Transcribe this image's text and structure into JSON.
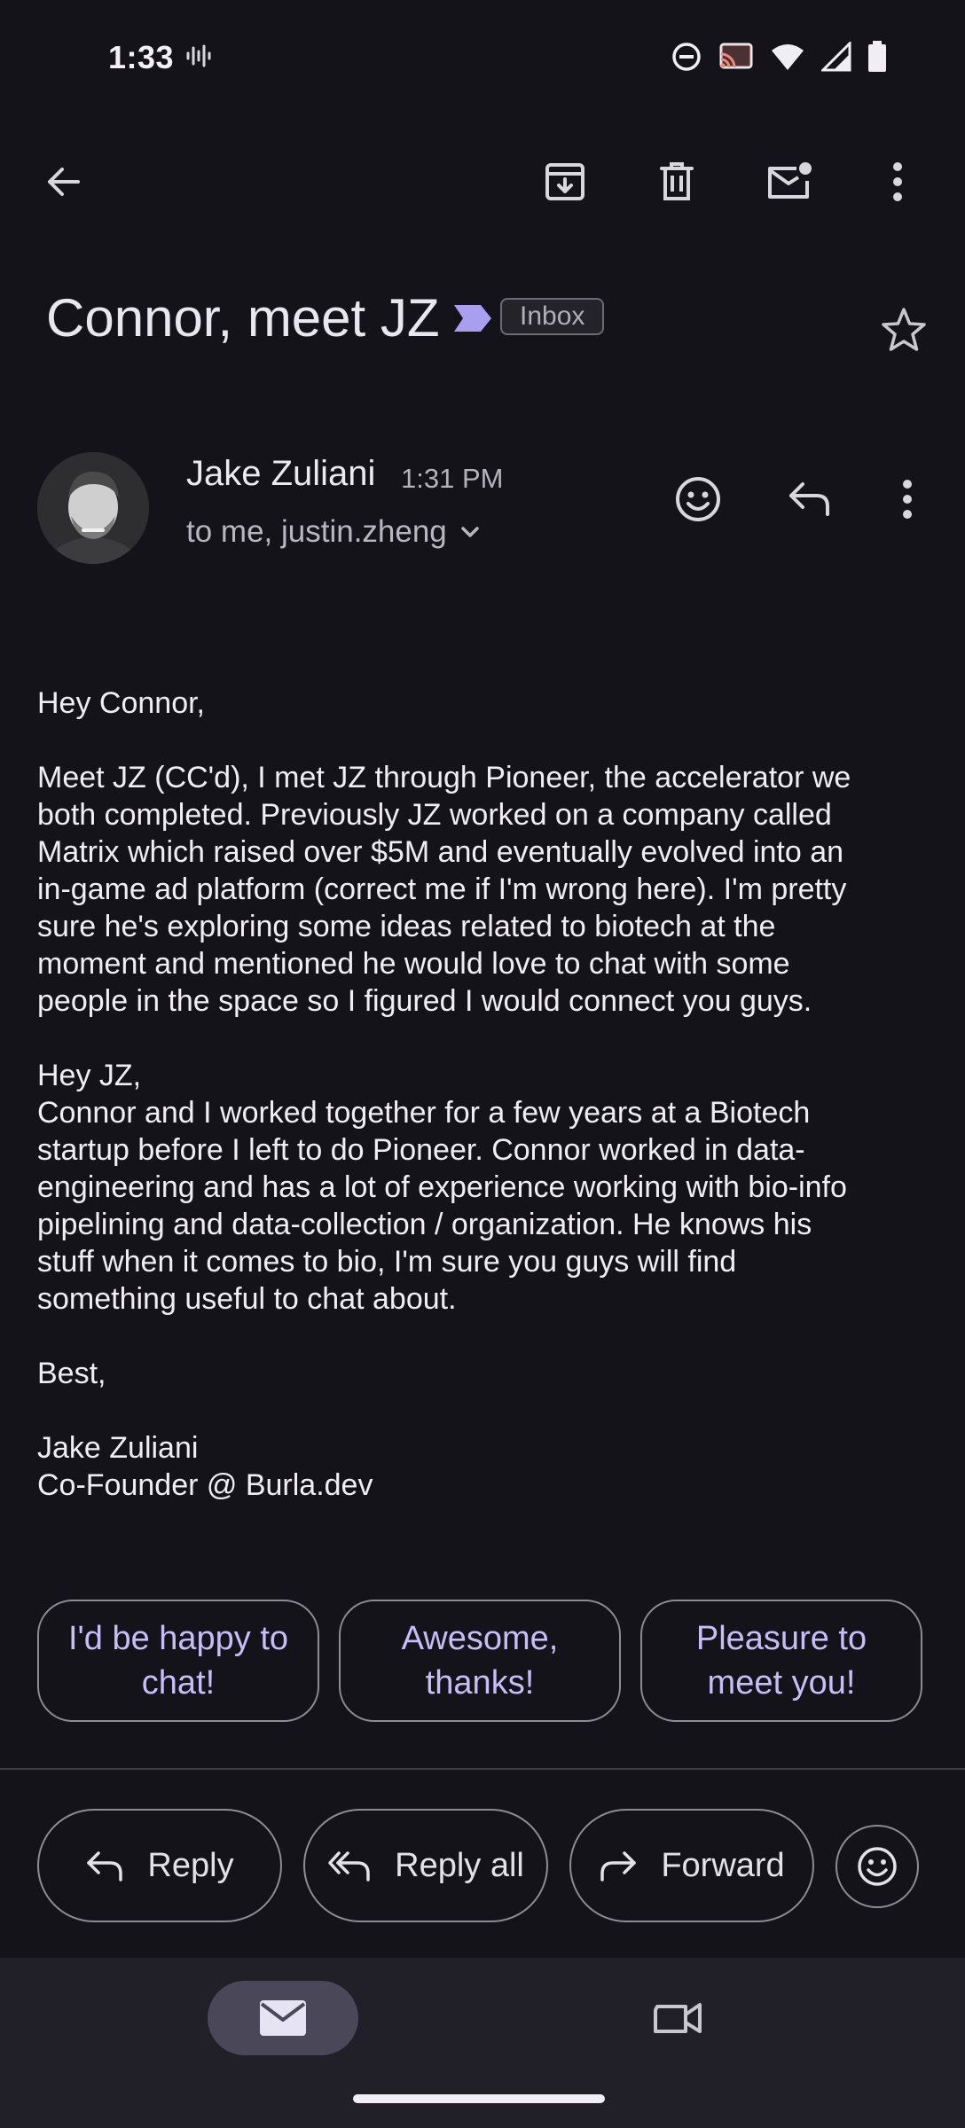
{
  "status_bar": {
    "time": "1:33",
    "icons": [
      "voicemail-icon",
      "do-not-disturb-icon",
      "cast-icon",
      "wifi-icon",
      "signal-icon",
      "battery-icon"
    ]
  },
  "toolbar": {
    "icons": [
      "back-arrow-icon",
      "archive-icon",
      "trash-icon",
      "mark-unread-icon",
      "more-vert-icon"
    ]
  },
  "email": {
    "subject": "Connor, meet JZ",
    "label": "Inbox",
    "sender_name": "Jake Zuliani",
    "time": "1:31 PM",
    "recipients": "to me, justin.zheng",
    "body": {
      "greeting1": "Hey Connor,",
      "para1_lines": [
        "Meet JZ (CC'd), I met JZ through Pioneer, the accelerator we",
        "both completed. Previously JZ worked on a company called",
        "Matrix which raised over $5M and eventually evolved into an",
        "in-game ad platform (correct me if I'm wrong here). I'm pretty",
        "sure he's exploring some ideas related to biotech at the",
        "moment and mentioned he would love to chat with some",
        "people in the space so I figured I would connect you guys."
      ],
      "greeting2": "Hey JZ,",
      "para2_lines": [
        "Connor and I worked together for a few years at a Biotech",
        "startup before I left to do Pioneer. Connor worked in data-",
        "engineering and has a lot of experience working with bio-info",
        "pipelining and data-collection / organization. He knows his",
        "stuff when it comes to bio, I'm sure you guys will find",
        "something useful to chat about."
      ],
      "signoff": "Best,",
      "signature_name": "Jake Zuliani",
      "signature_title": "Co-Founder @ Burla.dev"
    }
  },
  "smart_replies": [
    {
      "line1": "I'd be happy to",
      "line2": "chat!"
    },
    {
      "line1": "Awesome,",
      "line2": "thanks!"
    },
    {
      "line1": "Pleasure to",
      "line2": "meet you!"
    }
  ],
  "actions": {
    "reply": "Reply",
    "reply_all": "Reply all",
    "forward": "Forward"
  },
  "colors": {
    "background": "#14131a",
    "accent": "#c7bdf7",
    "importance": "#a99ef0",
    "nav_active": "#4a4759"
  }
}
